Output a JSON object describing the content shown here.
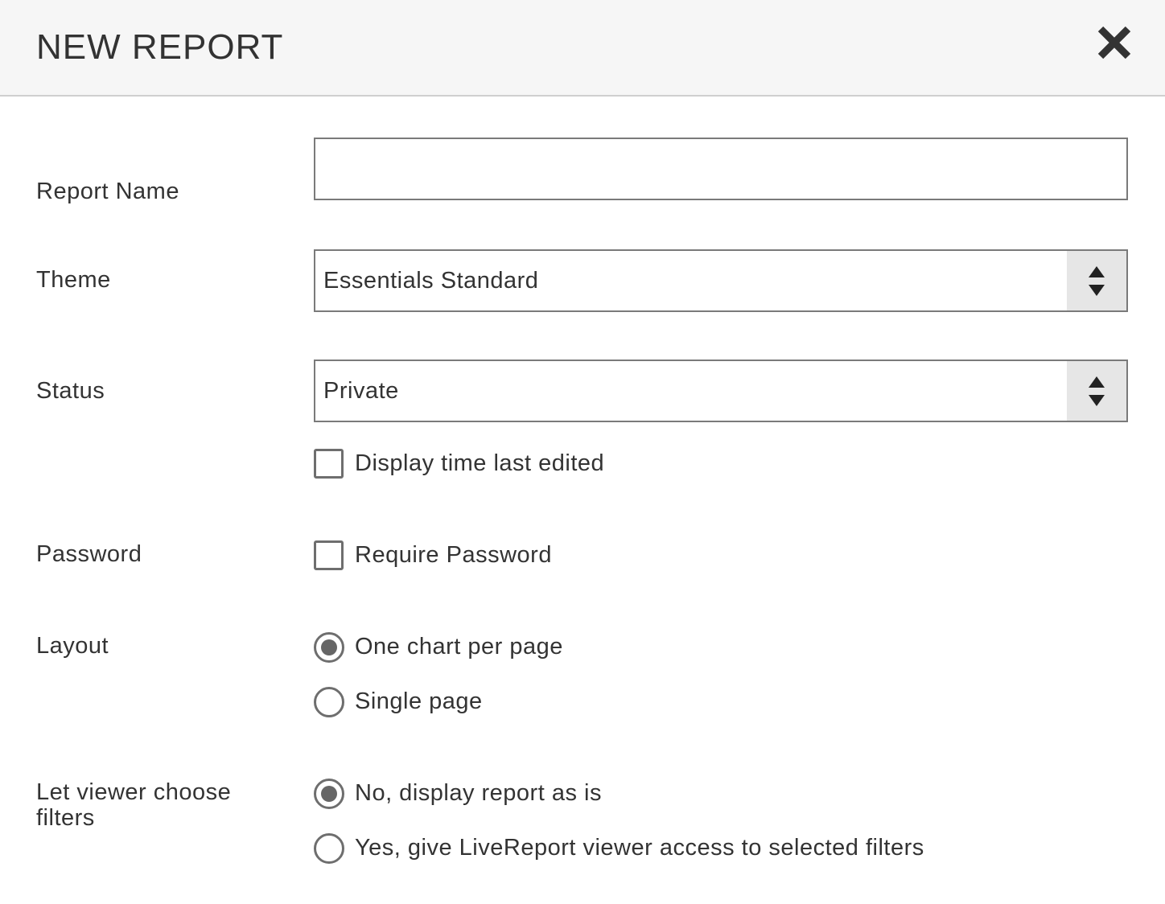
{
  "header": {
    "title": "NEW REPORT",
    "close_icon": "close-icon"
  },
  "form": {
    "report_name": {
      "label": "Report Name",
      "value": "",
      "placeholder": ""
    },
    "theme": {
      "label": "Theme",
      "selected": "Essentials Standard",
      "icon": "select-arrows-icon"
    },
    "status": {
      "label": "Status",
      "selected": "Private",
      "icon": "select-arrows-icon",
      "display_time_checkbox": {
        "label": "Display time last edited",
        "checked": false
      }
    },
    "password": {
      "label": "Password",
      "require_checkbox": {
        "label": "Require Password",
        "checked": false
      }
    },
    "layout": {
      "label": "Layout",
      "options": [
        {
          "label": "One chart per page",
          "checked": true
        },
        {
          "label": "Single page",
          "checked": false
        }
      ]
    },
    "filters": {
      "label": "Let viewer choose filters",
      "options": [
        {
          "label": "No, display report as is",
          "checked": true
        },
        {
          "label": "Yes, give LiveReport viewer access to selected filters",
          "checked": false
        }
      ]
    }
  },
  "colors": {
    "header_bg": "#f6f6f6",
    "border": "#7a7a7a",
    "text": "#333333",
    "select_arrow_bg": "#e6e6e6",
    "radio_fill": "#666666"
  }
}
